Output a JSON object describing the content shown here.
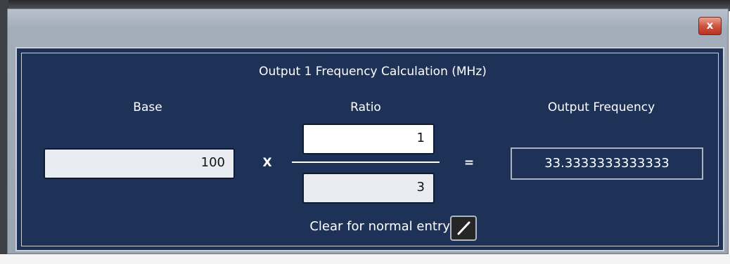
{
  "window": {
    "close_glyph": "x",
    "close_icon": "close-icon"
  },
  "panel": {
    "title": "Output 1 Frequency Calculation (MHz)"
  },
  "labels": {
    "base": "Base",
    "ratio": "Ratio",
    "output": "Output Frequency"
  },
  "operators": {
    "multiply": "X",
    "equals": "="
  },
  "fields": {
    "base_value": "100",
    "ratio_numerator": "1",
    "ratio_denominator": "3",
    "output_value": "33.3333333333333"
  },
  "clear_option": {
    "label": "Clear for normal entry",
    "checked": true,
    "icon": "check-slash-icon"
  },
  "colors": {
    "panel_bg": "#1e3258",
    "close_button": "#d0553f",
    "text": "#ffffff"
  }
}
